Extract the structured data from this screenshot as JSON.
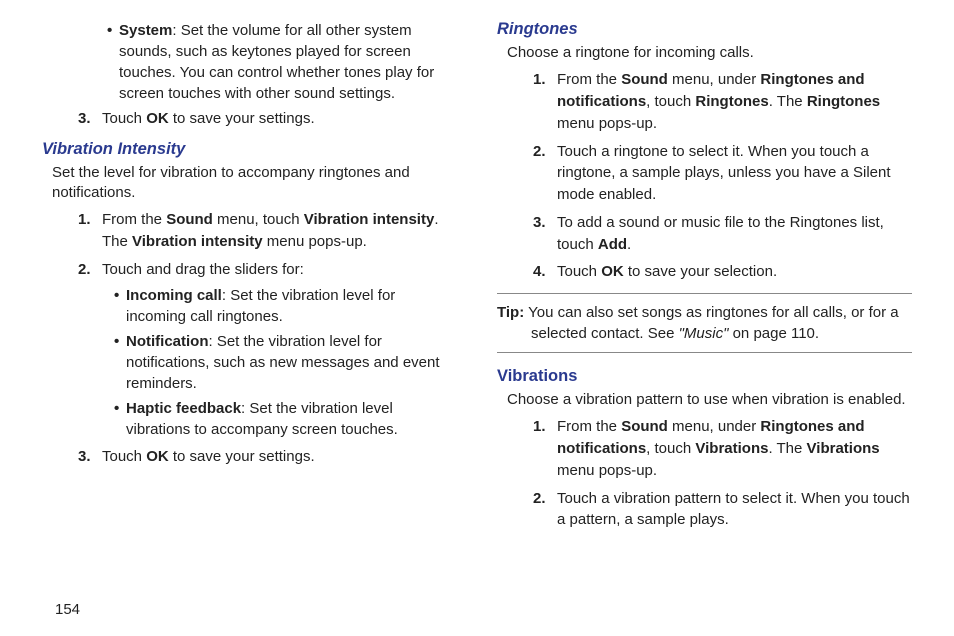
{
  "page_number": "154",
  "left": {
    "system_bullet_label": "System",
    "system_bullet_text": ": Set the volume for all other system sounds, such as keytones played for screen touches. You can control whether tones play for screen touches with other sound settings.",
    "step3_prefix": "Touch ",
    "step3_ok": "OK",
    "step3_suffix": " to save your settings.",
    "vib_heading": "Vibration Intensity",
    "vib_intro": "Set the level for vibration to accompany ringtones and notifications.",
    "vib_s1_a": "From the ",
    "vib_s1_sound": "Sound",
    "vib_s1_b": " menu, touch ",
    "vib_s1_vi": "Vibration intensity",
    "vib_s1_c": ". The ",
    "vib_s1_vi2": "Vibration intensity",
    "vib_s1_d": " menu pops-up.",
    "vib_s2": "Touch and drag the sliders for:",
    "vib_b1_label": "Incoming call",
    "vib_b1_text": ": Set the vibration level for incoming call ringtones.",
    "vib_b2_label": "Notification",
    "vib_b2_text": ": Set the vibration level for notifications, such as new messages and event reminders.",
    "vib_b3_label": "Haptic feedback",
    "vib_b3_text": ": Set the vibration level vibrations to accompany screen touches.",
    "vib_s3_a": "Touch ",
    "vib_s3_ok": "OK",
    "vib_s3_b": " to save your settings."
  },
  "right": {
    "ring_heading": "Ringtones",
    "ring_intro": "Choose a ringtone for incoming calls.",
    "ring_s1_a": "From the ",
    "ring_s1_sound": "Sound",
    "ring_s1_b": " menu, under ",
    "ring_s1_rn": "Ringtones and notifications",
    "ring_s1_c": ", touch ",
    "ring_s1_r": "Ringtones",
    "ring_s1_d": ". The ",
    "ring_s1_r2": "Ringtones",
    "ring_s1_e": " menu pops-up.",
    "ring_s2": "Touch a ringtone to select it. When you touch a ringtone, a sample plays, unless you have a Silent mode enabled.",
    "ring_s3_a": "To add a sound or music file to the Ringtones list, touch ",
    "ring_s3_add": "Add",
    "ring_s3_b": ".",
    "ring_s4_a": "Touch ",
    "ring_s4_ok": "OK",
    "ring_s4_b": " to save your selection.",
    "tip_label": "Tip:",
    "tip_a": " You can also set songs as ringtones for all calls, or for a selected contact. See ",
    "tip_music": "\"Music\"",
    "tip_b": " on page 110.",
    "vibs_heading": "Vibrations",
    "vibs_intro": "Choose a vibration pattern to use when vibration is enabled.",
    "vibs_s1_a": "From the ",
    "vibs_s1_sound": "Sound",
    "vibs_s1_b": " menu, under ",
    "vibs_s1_rn": "Ringtones and notifications",
    "vibs_s1_c": ", touch ",
    "vibs_s1_v": "Vibrations",
    "vibs_s1_d": ". The ",
    "vibs_s1_v2": "Vibrations",
    "vibs_s1_e": " menu pops-up.",
    "vibs_s2": "Touch a vibration pattern to select it. When you touch a pattern, a sample plays."
  }
}
